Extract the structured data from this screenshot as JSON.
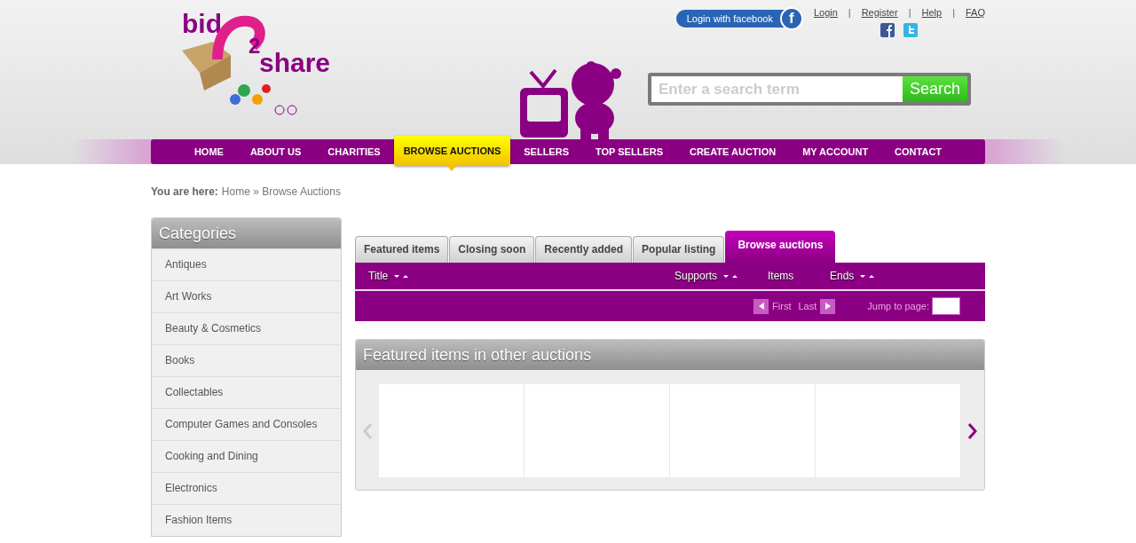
{
  "logo": {
    "word_1": "bid",
    "digit": "2",
    "word_2": "share"
  },
  "facebook_login": {
    "label": "Login with facebook",
    "icon_letter": "f"
  },
  "top_links": [
    {
      "label": "Login"
    },
    {
      "label": "Register"
    },
    {
      "label": "Help"
    },
    {
      "label": "FAQ"
    }
  ],
  "link_separator": "|",
  "search": {
    "placeholder": "Enter a search term",
    "button": "Search"
  },
  "nav": [
    {
      "label": "HOME",
      "selected": false
    },
    {
      "label": "ABOUT US",
      "selected": false
    },
    {
      "label": "CHARITIES",
      "selected": false
    },
    {
      "label": "BROWSE AUCTIONS",
      "selected": true
    },
    {
      "label": "SELLERS",
      "selected": false
    },
    {
      "label": "TOP SELLERS",
      "selected": false
    },
    {
      "label": "CREATE AUCTION",
      "selected": false
    },
    {
      "label": "MY ACCOUNT",
      "selected": false
    },
    {
      "label": "CONTACT",
      "selected": false
    }
  ],
  "breadcrumb": {
    "prefix": "You are here:",
    "items": [
      "Home",
      "Browse Auctions"
    ],
    "separator": "»"
  },
  "sidebar": {
    "title": "Categories",
    "items": [
      "Antiques",
      "Art Works",
      "Beauty & Cosmetics",
      "Books",
      "Collectables",
      "Computer Games and Consoles",
      "Cooking and Dining",
      "Electronics",
      "Fashion Items"
    ]
  },
  "tabs": [
    {
      "label": "Featured items",
      "selected": false
    },
    {
      "label": "Closing soon",
      "selected": false
    },
    {
      "label": "Recently added",
      "selected": false
    },
    {
      "label": "Popular listing",
      "selected": false
    },
    {
      "label": "Browse auctions",
      "selected": true
    }
  ],
  "table": {
    "columns": [
      {
        "label": "Title",
        "kind": "sortable"
      },
      {
        "label": "Supports",
        "kind": "sortable"
      },
      {
        "label": "Items",
        "kind": "plain"
      },
      {
        "label": "Ends",
        "kind": "sortable"
      }
    ]
  },
  "pager": {
    "first": "First",
    "last": "Last",
    "jump_label": "Jump to page:"
  },
  "featured": {
    "title": "Featured items in other auctions"
  }
}
